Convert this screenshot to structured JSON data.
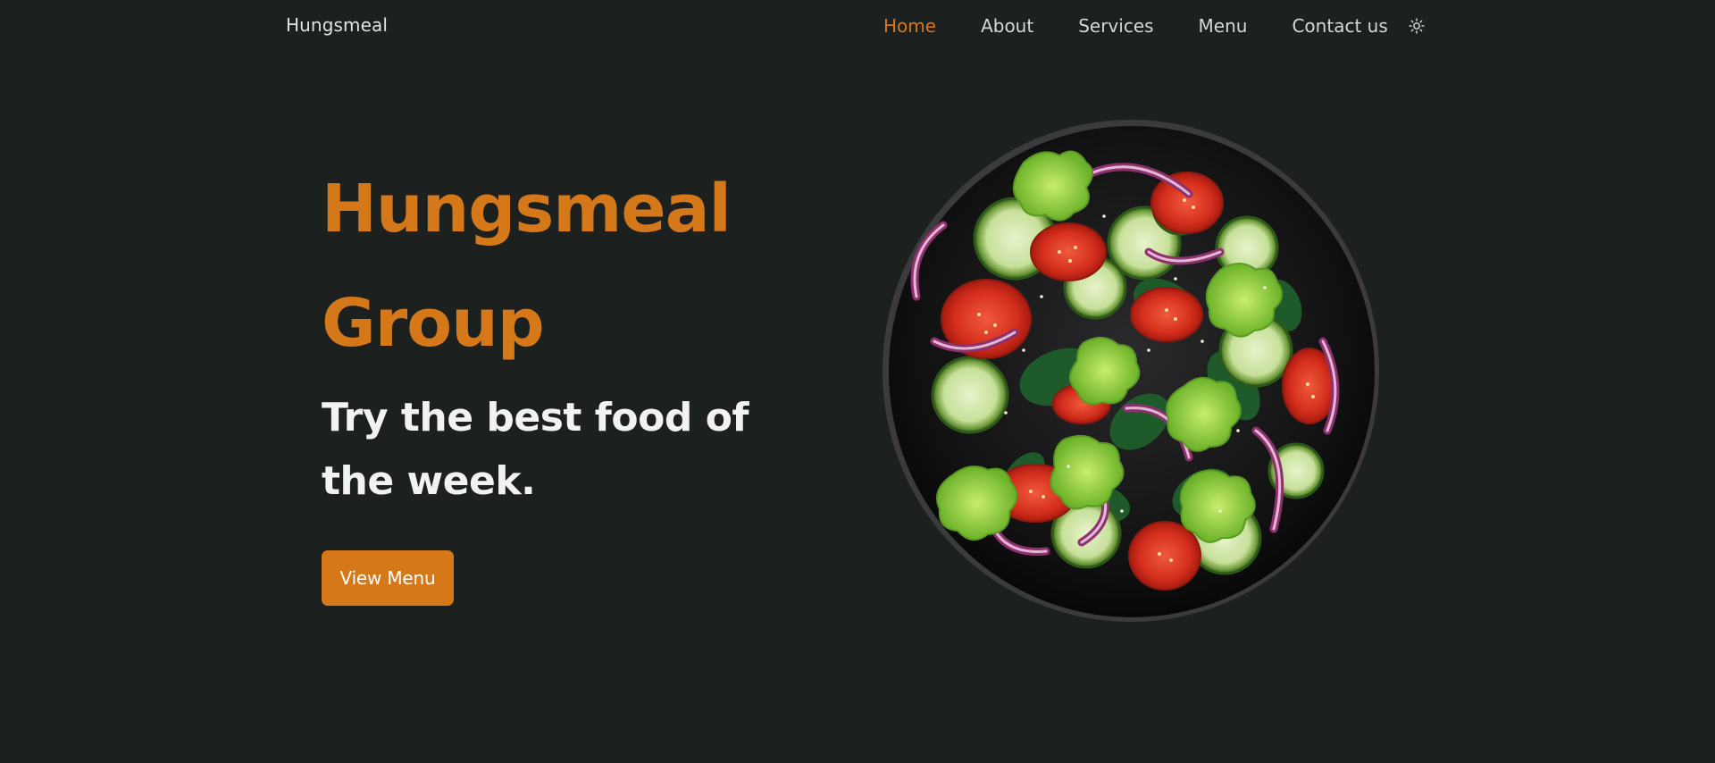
{
  "header": {
    "brand": "Hungsmeal",
    "nav": [
      {
        "label": "Home",
        "active": true
      },
      {
        "label": "About",
        "active": false
      },
      {
        "label": "Services",
        "active": false
      },
      {
        "label": "Menu",
        "active": false
      },
      {
        "label": "Contact us",
        "active": false
      }
    ],
    "theme_toggle_icon": "sun-icon"
  },
  "hero": {
    "title_line1": "Hungsmeal",
    "title_line2": "Group",
    "subtitle": "Try the best food of the week.",
    "cta_label": "View Menu",
    "image": "salad-bowl"
  },
  "colors": {
    "background": "#1c2120",
    "accent": "#d4781a",
    "text": "#f2f2f2",
    "nav_text": "#d6d6d6"
  }
}
